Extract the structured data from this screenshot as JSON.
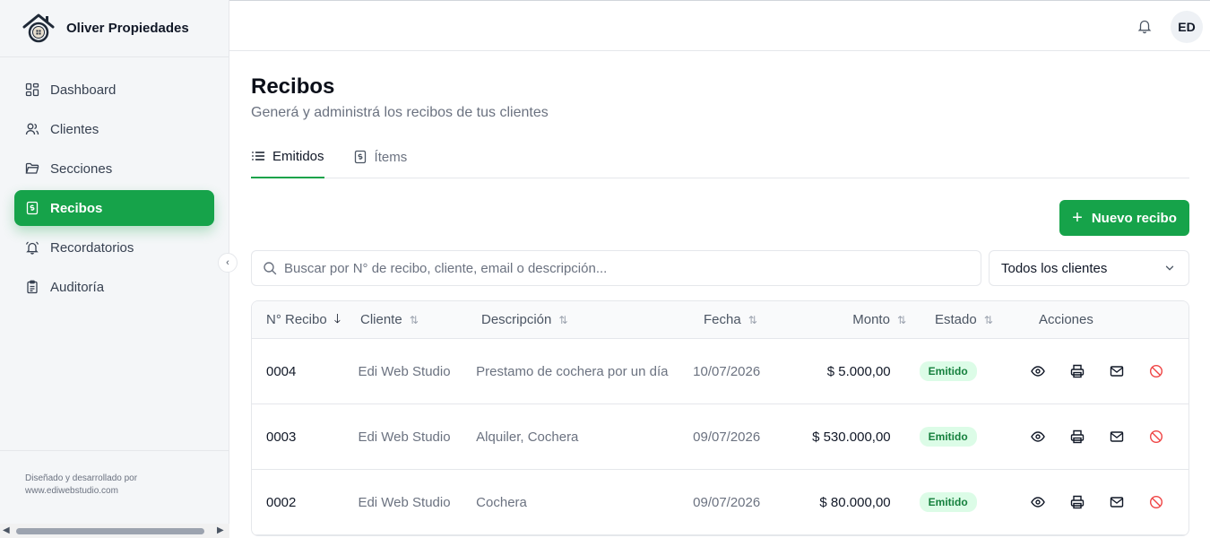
{
  "brand": {
    "name": "Oliver Propiedades"
  },
  "sidebar": {
    "items": [
      {
        "label": "Dashboard",
        "icon": "dashboard-icon"
      },
      {
        "label": "Clientes",
        "icon": "users-icon"
      },
      {
        "label": "Secciones",
        "icon": "folder-icon"
      },
      {
        "label": "Recibos",
        "icon": "receipt-icon",
        "active": true
      },
      {
        "label": "Recordatorios",
        "icon": "bell-ring-icon"
      },
      {
        "label": "Auditoría",
        "icon": "clipboard-icon"
      }
    ],
    "footer_line1": "Diseñado y desarrollado por",
    "footer_line2": "www.ediwebstudio.com"
  },
  "topbar": {
    "avatar_initials": "ED"
  },
  "page": {
    "title": "Recibos",
    "subtitle": "Generá y administrá los recibos de tus clientes"
  },
  "tabs": [
    {
      "label": "Emitidos",
      "active": true
    },
    {
      "label": "Ítems",
      "active": false
    }
  ],
  "new_button": {
    "label": "Nuevo recibo"
  },
  "search": {
    "placeholder": "Buscar por N° de recibo, cliente, email o descripción..."
  },
  "client_filter": {
    "selected": "Todos los clientes"
  },
  "table": {
    "headers": {
      "num": "N° Recibo",
      "client": "Cliente",
      "desc": "Descripción",
      "date": "Fecha",
      "amount": "Monto",
      "status": "Estado",
      "actions": "Acciones"
    },
    "rows": [
      {
        "num": "0004",
        "client": "Edi Web Studio",
        "desc": "Prestamo de cochera por un día",
        "date": "10/07/2026",
        "amount": "$ 5.000,00",
        "status": "Emitido"
      },
      {
        "num": "0003",
        "client": "Edi Web Studio",
        "desc": "Alquiler, Cochera",
        "date": "09/07/2026",
        "amount": "$ 530.000,00",
        "status": "Emitido"
      },
      {
        "num": "0002",
        "client": "Edi Web Studio",
        "desc": "Cochera",
        "date": "09/07/2026",
        "amount": "$ 80.000,00",
        "status": "Emitido"
      }
    ]
  },
  "colors": {
    "accent": "#16a34a",
    "badge_bg": "#dcfce7",
    "badge_text": "#15803d",
    "danger": "#ef4444"
  }
}
